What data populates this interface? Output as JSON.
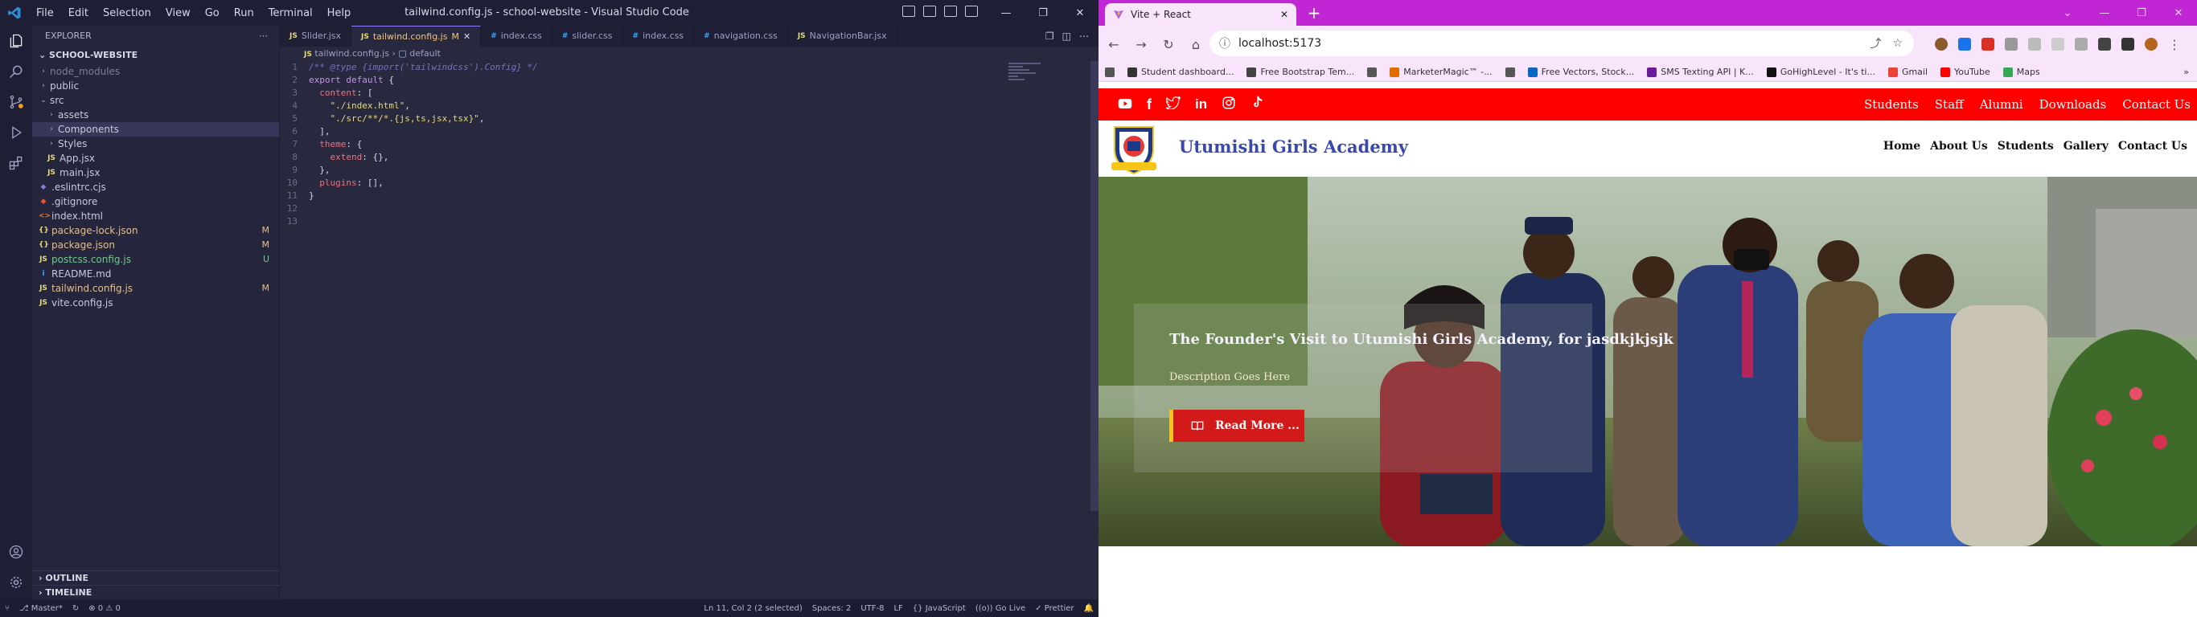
{
  "vscode": {
    "menu": [
      "File",
      "Edit",
      "Selection",
      "View",
      "Go",
      "Run",
      "Terminal",
      "Help"
    ],
    "title": "tailwind.config.js - school-website - Visual Studio Code",
    "explorer": {
      "header": "EXPLORER",
      "project": "SCHOOL-WEBSITE",
      "tree": [
        {
          "label": "node_modules",
          "kind": "folder",
          "depth": 1,
          "open": false,
          "color": "#7b7f9e",
          "status": ""
        },
        {
          "label": "public",
          "kind": "folder",
          "depth": 1,
          "open": false,
          "color": "#c9c9dd",
          "status": ""
        },
        {
          "label": "src",
          "kind": "folder",
          "depth": 1,
          "open": true,
          "color": "#c9c9dd",
          "status": ""
        },
        {
          "label": "assets",
          "kind": "folder",
          "depth": 2,
          "open": false,
          "color": "#c9c9dd",
          "status": ""
        },
        {
          "label": "Components",
          "kind": "folder",
          "depth": 2,
          "open": false,
          "color": "#c9c9dd",
          "status": "",
          "selected": true
        },
        {
          "label": "Styles",
          "kind": "folder",
          "depth": 2,
          "open": false,
          "color": "#c9c9dd",
          "status": ""
        },
        {
          "label": "App.jsx",
          "kind": "jsx",
          "depth": 2,
          "color": "#c9c9dd",
          "status": ""
        },
        {
          "label": "main.jsx",
          "kind": "jsx",
          "depth": 2,
          "color": "#c9c9dd",
          "status": ""
        },
        {
          "label": ".eslintrc.cjs",
          "kind": "eslint",
          "depth": 1,
          "color": "#c9c9dd",
          "status": ""
        },
        {
          "label": ".gitignore",
          "kind": "git",
          "depth": 1,
          "color": "#c9c9dd",
          "status": ""
        },
        {
          "label": "index.html",
          "kind": "html",
          "depth": 1,
          "color": "#c9c9dd",
          "status": ""
        },
        {
          "label": "package-lock.json",
          "kind": "json",
          "depth": 1,
          "color": "#e2c08d",
          "status": "M"
        },
        {
          "label": "package.json",
          "kind": "json",
          "depth": 1,
          "color": "#e2c08d",
          "status": "M"
        },
        {
          "label": "postcss.config.js",
          "kind": "js",
          "depth": 1,
          "color": "#73c991",
          "status": "U"
        },
        {
          "label": "README.md",
          "kind": "md",
          "depth": 1,
          "color": "#c9c9dd",
          "status": ""
        },
        {
          "label": "tailwind.config.js",
          "kind": "js",
          "depth": 1,
          "color": "#e2c08d",
          "status": "M"
        },
        {
          "label": "vite.config.js",
          "kind": "js",
          "depth": 1,
          "color": "#c9c9dd",
          "status": ""
        }
      ],
      "outline": "OUTLINE",
      "timeline": "TIMELINE"
    },
    "tabs": [
      {
        "label": "Slider.jsx",
        "icon": "jsx",
        "active": false,
        "badge": ""
      },
      {
        "label": "tailwind.config.js",
        "icon": "js",
        "active": true,
        "badge": "M"
      },
      {
        "label": "index.css",
        "icon": "css",
        "active": false,
        "badge": ""
      },
      {
        "label": "slider.css",
        "icon": "css",
        "active": false,
        "badge": ""
      },
      {
        "label": "index.css",
        "icon": "css",
        "active": false,
        "badge": ""
      },
      {
        "label": "navigation.css",
        "icon": "css",
        "active": false,
        "badge": ""
      },
      {
        "label": "NavigationBar.jsx",
        "icon": "jsx",
        "active": false,
        "badge": ""
      }
    ],
    "breadcrumb": {
      "file": "tailwind.config.js",
      "symbol": "default"
    },
    "code": [
      [
        [
          "c",
          "/** @type {import('tailwindcss').Config} */"
        ]
      ],
      [
        [
          "k",
          "export default"
        ],
        [
          "b",
          " {"
        ]
      ],
      [
        [
          "p",
          "  content"
        ],
        [
          "b",
          ": ["
        ]
      ],
      [
        [
          "s",
          "    \"./index.html\""
        ],
        [
          "b",
          ","
        ]
      ],
      [
        [
          "s",
          "    \"./src/**/*.{js,ts,jsx,tsx}\""
        ],
        [
          "b",
          ","
        ]
      ],
      [
        [
          "b",
          "  ],"
        ]
      ],
      [
        [
          "p",
          "  theme"
        ],
        [
          "b",
          ": {"
        ]
      ],
      [
        [
          "p",
          "    extend"
        ],
        [
          "b",
          ": {},"
        ]
      ],
      [
        [
          "b",
          "  },"
        ]
      ],
      [
        [
          "p",
          "  plugins"
        ],
        [
          "b",
          ": [],"
        ]
      ],
      [
        [
          "b",
          "}"
        ]
      ],
      [
        [
          "b",
          ""
        ]
      ],
      [
        [
          "b",
          ""
        ]
      ]
    ],
    "status": {
      "branch": "Master*",
      "problems": "⊗ 0 ⚠ 0",
      "cursor": "Ln 11, Col 2 (2 selected)",
      "spaces": "Spaces: 2",
      "encoding": "UTF-8",
      "eol": "LF",
      "language": "{} JavaScript",
      "golive": "Go Live",
      "prettier": "✓ Prettier"
    }
  },
  "chrome": {
    "tab_title": "Vite + React",
    "url": "localhost:5173",
    "bookmarks": [
      {
        "label": "",
        "color": "#555"
      },
      {
        "label": "Student dashboard...",
        "color": "#333"
      },
      {
        "label": "Free Bootstrap Tem...",
        "color": "#444"
      },
      {
        "label": "",
        "color": "#555"
      },
      {
        "label": "MarketerMagic™ -...",
        "color": "#e06c00"
      },
      {
        "label": "",
        "color": "#555"
      },
      {
        "label": "Free Vectors, Stock...",
        "color": "#0a66c2"
      },
      {
        "label": "SMS Texting API | K...",
        "color": "#6a1b9a"
      },
      {
        "label": "GoHighLevel - It's ti...",
        "color": "#111"
      },
      {
        "label": "Gmail",
        "color": "#ea4335"
      },
      {
        "label": "YouTube",
        "color": "#ff0000"
      },
      {
        "label": "Maps",
        "color": "#34a853"
      }
    ]
  },
  "site": {
    "social": [
      "youtube-icon",
      "facebook-icon",
      "twitter-icon",
      "linkedin-icon",
      "instagram-icon",
      "tiktok-icon"
    ],
    "top_nav": [
      "Students",
      "Staff",
      "Alumni",
      "Downloads",
      "Contact Us"
    ],
    "school_name": "Utumishi Girls Academy",
    "main_nav": [
      "Home",
      "About Us",
      "Students",
      "Gallery",
      "Contact Us"
    ],
    "hero": {
      "title": "The Founder's Visit to Utumishi Girls Academy, for jasdkjkjsjk",
      "description": "Description Goes Here",
      "button": "Read More ..."
    },
    "colors": {
      "topbar": "#ff0000",
      "brand": "#3949ab",
      "button": "#d31a1a",
      "button_accent": "#f5c518"
    }
  }
}
